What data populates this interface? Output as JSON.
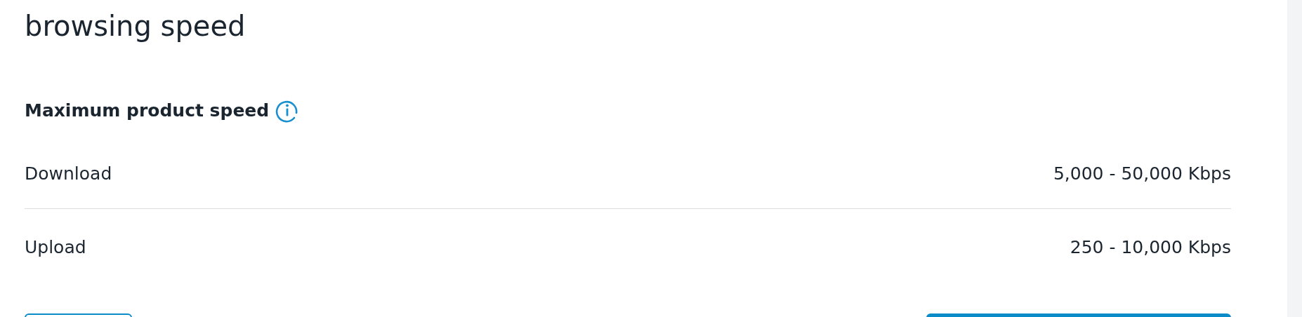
{
  "title": "browsing speed",
  "section": {
    "heading": "Maximum product speed"
  },
  "rows": [
    {
      "label": "Download",
      "value": "5,000 - 50,000 Kbps"
    },
    {
      "label": "Upload",
      "value": "250 - 10,000 Kbps"
    }
  ],
  "buttons": [
    {
      "kind": "outline"
    },
    {
      "kind": "primary"
    }
  ]
}
